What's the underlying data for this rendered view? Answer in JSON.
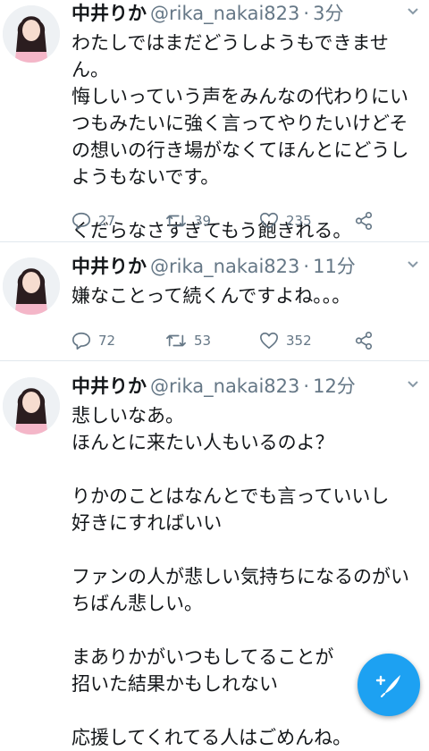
{
  "tweets": [
    {
      "name": "中井りか",
      "handle": "@rika_nakai823",
      "time": "3分",
      "text": "わたしではまだどうしようもできません。\n悔しいっていう声をみんなの代わりにいつもみたいに強く言ってやりたいけどその想いの行き場がなくてほんとにどうしようもないです。\n\nくだらなさすぎてもう飽きれる。",
      "replies": "27",
      "retweets": "39",
      "likes": "235"
    },
    {
      "name": "中井りか",
      "handle": "@rika_nakai823",
      "time": "11分",
      "text": "嫌なことって続くんですよね。。。",
      "replies": "72",
      "retweets": "53",
      "likes": "352"
    },
    {
      "name": "中井りか",
      "handle": "@rika_nakai823",
      "time": "12分",
      "text": "悲しいなあ。\nほんとに来たい人もいるのよ？\n\nりかのことはなんとでも言っていいし\n好きにすればいい\n\nファンの人が悲しい気持ちになるのがいちばん悲しい。\n\nまありかがいつもしてることが\n招いた結果かもしれない\n\n応援してくれてる人はごめんね。"
    }
  ],
  "icons": {
    "reply": "reply-icon",
    "retweet": "retweet-icon",
    "like": "heart-icon",
    "share": "share-icon",
    "caret": "chevron-down-icon",
    "compose": "compose-tweet-icon"
  },
  "colors": {
    "accent": "#1da1f2",
    "text": "#14171a",
    "secondary": "#657786",
    "divider": "#e1e8ed"
  }
}
